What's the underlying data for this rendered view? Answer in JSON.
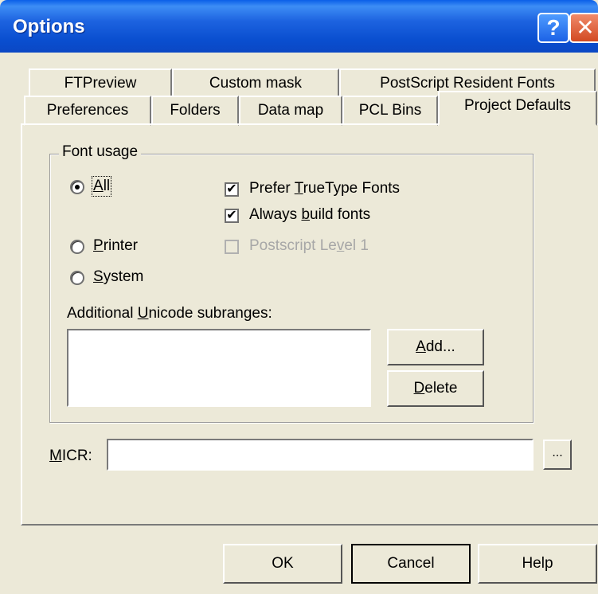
{
  "window": {
    "title": "Options"
  },
  "title_buttons": {
    "help": "?",
    "close": "✕"
  },
  "tabs_back": [
    "FTPreview",
    "Custom mask",
    "PostScript Resident Fonts"
  ],
  "tabs_front": [
    "Preferences",
    "Folders",
    "Data map",
    "PCL Bins",
    "Project Defaults"
  ],
  "active_tab": "Project Defaults",
  "font_usage": {
    "label": "Font usage",
    "radios": [
      {
        "pre": "",
        "key": "A",
        "post": "ll",
        "checked": true
      },
      {
        "pre": "",
        "key": "P",
        "post": "rinter",
        "checked": false
      },
      {
        "pre": "",
        "key": "S",
        "post": "ystem",
        "checked": false
      }
    ],
    "checkboxes": [
      {
        "pre": "Prefer ",
        "key": "T",
        "post": "rueType Fonts",
        "checked": true,
        "enabled": true,
        "mark": "✔"
      },
      {
        "pre": "Always ",
        "key": "b",
        "post": "uild fonts",
        "checked": true,
        "enabled": true,
        "mark": "✔"
      },
      {
        "pre": "Postscript Le",
        "key": "v",
        "post": "el 1",
        "checked": false,
        "enabled": false,
        "mark": ""
      }
    ]
  },
  "unicode": {
    "label_pre": "Additional ",
    "label_key": "U",
    "label_post": "nicode subranges:",
    "add_pre": "",
    "add_key": "A",
    "add_post": "dd...",
    "delete_pre": "",
    "delete_key": "D",
    "delete_post": "elete"
  },
  "micr": {
    "label_pre": "",
    "label_key": "M",
    "label_post": "ICR:",
    "value": "",
    "browse": "..."
  },
  "footer": {
    "ok": "OK",
    "cancel": "Cancel",
    "help": "Help"
  }
}
